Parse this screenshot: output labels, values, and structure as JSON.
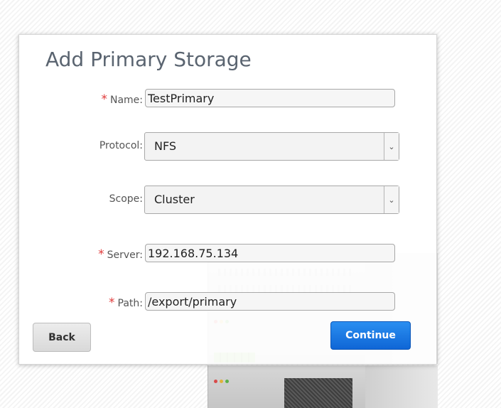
{
  "dialog": {
    "title": "Add Primary Storage",
    "fields": {
      "name": {
        "label": "Name:",
        "required": "*",
        "value": "TestPrimary"
      },
      "protocol": {
        "label": "Protocol:",
        "value": "NFS"
      },
      "scope": {
        "label": "Scope:",
        "value": "Cluster"
      },
      "server": {
        "label": "Server:",
        "required": "*",
        "value": "192.168.75.134"
      },
      "path": {
        "label": "Path:",
        "required": "*",
        "value": "/export/primary"
      }
    },
    "buttons": {
      "back": "Back",
      "continue": "Continue"
    },
    "icons": {
      "dropdown": "chevron-down-icon"
    },
    "colors": {
      "required": "#e03a3a",
      "primary_button": "#1a7ae6",
      "title": "#5a6470"
    }
  }
}
